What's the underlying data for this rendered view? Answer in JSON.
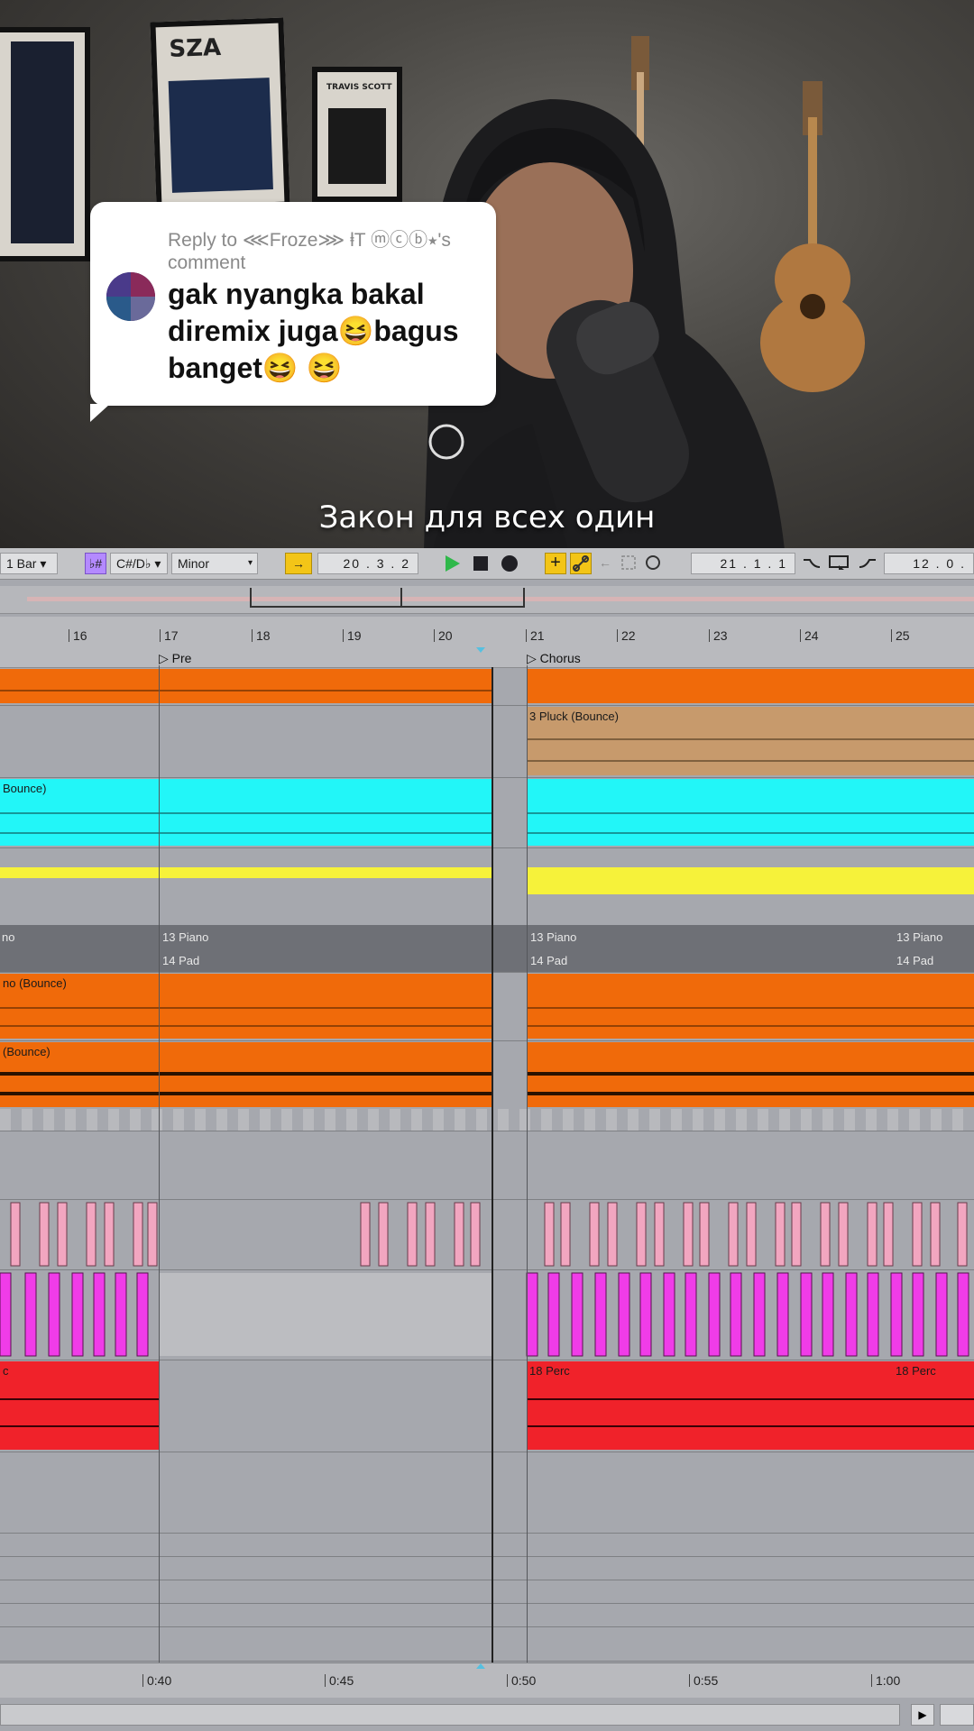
{
  "video": {
    "poster_left": "SZA",
    "poster_right": "TRAVIS SCOTT",
    "caption": "Закон для всех один"
  },
  "reply": {
    "header": "Reply to ⋘Froze⋙ ⱡT ⓜⓒⓑ⭑'s comment",
    "text": "gak nyangka bakal diremix juga😆bagus banget😆 😆"
  },
  "toolbar": {
    "quantize": "1 Bar ▾",
    "scale_icon": "♭#",
    "key": "C#/D♭ ▾",
    "mode": "Minor",
    "follow_icon": "→",
    "position": "20 .  3 .  2",
    "loop_start": "21 .  1 .  1",
    "loop_length": "12 .  0 ."
  },
  "ruler": {
    "bars": [
      "16",
      "17",
      "18",
      "19",
      "20",
      "21",
      "22",
      "23",
      "24",
      "25"
    ]
  },
  "locators": {
    "pre": "Pre",
    "chorus": "Chorus"
  },
  "clips": {
    "pluck": "3 Pluck (Bounce)",
    "cyan": "Bounce)",
    "piano_left": "no",
    "piano": "13 Piano",
    "pad": "14 Pad",
    "orange2": "no (Bounce)",
    "orange3": "(Bounce)",
    "perc": "18 Perc",
    "perc_left": "c"
  },
  "timeaxis": {
    "labels": [
      "0:40",
      "0:45",
      "0:50",
      "0:55",
      "1:00"
    ]
  },
  "scroll": {
    "button": "▶"
  }
}
